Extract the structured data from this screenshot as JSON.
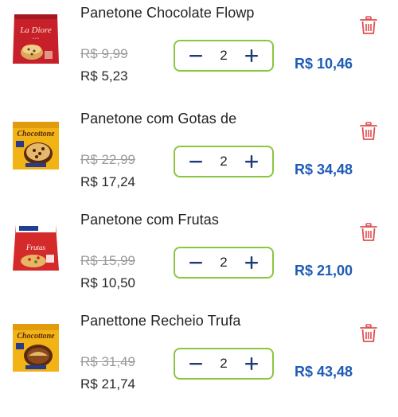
{
  "cart": {
    "items": [
      {
        "name": "Panetone Chocolate Flowp",
        "old_price": "R$ 9,99",
        "price": "R$ 5,23",
        "quantity": "2",
        "total": "R$ 10,46",
        "image": {
          "brand": "La Diore",
          "style": "red-bag"
        }
      },
      {
        "name": "Panetone com Gotas de",
        "old_price": "R$ 22,99",
        "price": "R$ 17,24",
        "quantity": "2",
        "total": "R$ 34,48",
        "image": {
          "brand": "Chocottone",
          "style": "yellow-box"
        }
      },
      {
        "name": "Panetone com Frutas",
        "old_price": "R$ 15,99",
        "price": "R$ 10,50",
        "quantity": "2",
        "total": "R$ 21,00",
        "image": {
          "brand": "Frutas",
          "style": "red-box"
        }
      },
      {
        "name": "Panettone Recheio Trufa",
        "old_price": "R$ 31,49",
        "price": "R$ 21,74",
        "quantity": "2",
        "total": "R$ 43,48",
        "image": {
          "brand": "Chocottone",
          "style": "yellow-box"
        }
      }
    ]
  },
  "colors": {
    "accent_blue": "#1e5bb8",
    "stepper_border": "#8cc63f",
    "stepper_icon": "#1c3a78",
    "trash_red": "#e05050"
  },
  "icons": {
    "decrement": "minus-icon",
    "increment": "plus-icon",
    "remove": "trash-icon"
  }
}
